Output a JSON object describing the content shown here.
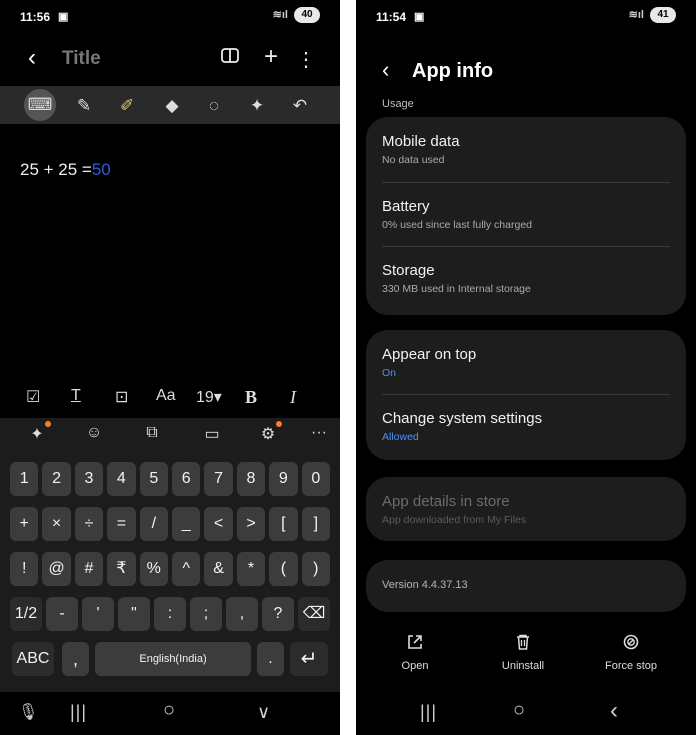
{
  "left": {
    "status": {
      "time": "11:56",
      "media_icon": "screen-record-icon",
      "battery": "40"
    },
    "header": {
      "back": "‹",
      "title": "Title",
      "icons": [
        "book-icon",
        "plus-icon",
        "more-vert-icon"
      ]
    },
    "pen_tools": [
      "keyboard-icon",
      "pen-icon",
      "highlighter-icon",
      "eraser-icon",
      "lasso-icon",
      "ai-sparkle-icon",
      "undo-icon"
    ],
    "note": {
      "expr": "25 + 25 =",
      "answer": "50"
    },
    "format_bar": {
      "checkbox": "☑",
      "text_style": "T",
      "text_box": "⊡",
      "font": "Aa",
      "size": "19▾",
      "bold": "B",
      "italic": "I"
    },
    "quick_bar": [
      "ai-sparkle-icon",
      "emoji-icon",
      "translate-icon",
      "clipboard-icon",
      "settings-icon",
      "more-icon"
    ],
    "keyboard": {
      "row1": [
        "1",
        "2",
        "3",
        "4",
        "5",
        "6",
        "7",
        "8",
        "9",
        "0"
      ],
      "row2": [
        "+",
        "×",
        "÷",
        "=",
        "/",
        "_",
        "<",
        ">",
        "[",
        "]"
      ],
      "row3": [
        "!",
        "@",
        "#",
        "₹",
        "%",
        "^",
        "&",
        "*",
        "(",
        ")"
      ],
      "row4": [
        "1/2",
        "-",
        "'",
        "\"",
        ":",
        ";",
        ",",
        "?",
        "⌫"
      ],
      "row5": {
        "abc": "ABC",
        "comma": ",",
        "space": "English(India)",
        "period": ".",
        "enter": "↵"
      }
    },
    "nav": {
      "mic": "mic-icon",
      "recents": "|||",
      "home": "○",
      "hide": "∨"
    }
  },
  "right": {
    "status": {
      "time": "11:54",
      "media_icon": "screen-record-icon",
      "battery": "41"
    },
    "header": {
      "back": "‹",
      "title": "App info"
    },
    "usage_label": "Usage",
    "usage": [
      {
        "title": "Mobile data",
        "sub": "No data used"
      },
      {
        "title": "Battery",
        "sub": "0% used since last fully charged"
      },
      {
        "title": "Storage",
        "sub": "330 MB used in Internal storage"
      }
    ],
    "permissions": [
      {
        "title": "Appear on top",
        "sub": "On"
      },
      {
        "title": "Change system settings",
        "sub": "Allowed"
      }
    ],
    "store": {
      "title": "App details in store",
      "sub": "App downloaded from My Files"
    },
    "version": "Version 4.4.37.13",
    "actions": [
      {
        "label": "Open",
        "icon": "open-external-icon"
      },
      {
        "label": "Uninstall",
        "icon": "trash-icon"
      },
      {
        "label": "Force stop",
        "icon": "stop-icon"
      }
    ],
    "nav": {
      "recents": "|||",
      "home": "○",
      "back": "‹"
    }
  },
  "colors": {
    "accent_blue": "#4f8ff7",
    "answer_blue": "#2f5cdb",
    "notification_dot": "#ff7a2f",
    "card": "#1d1d1d"
  }
}
